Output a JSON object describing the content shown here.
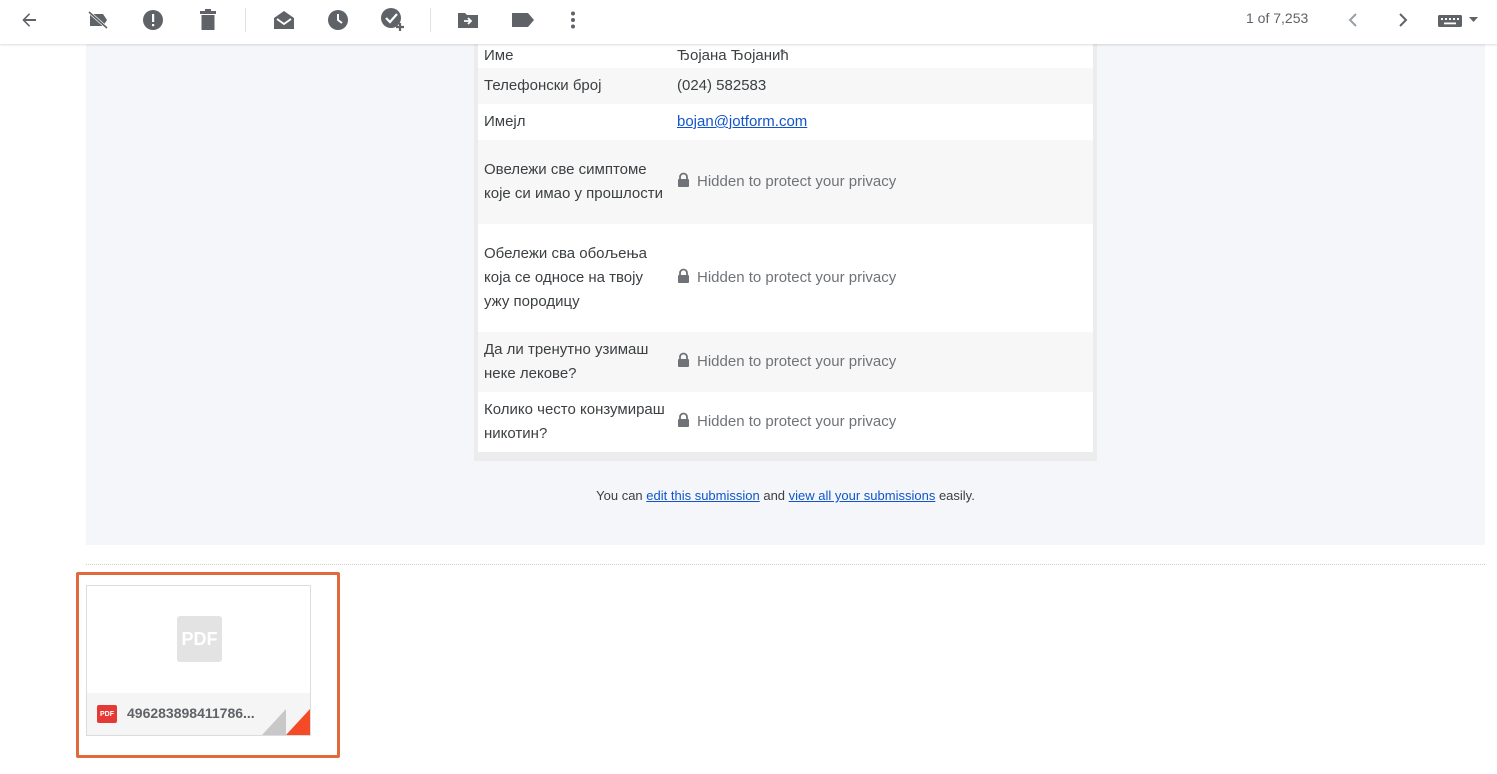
{
  "toolbar": {
    "buttons": [
      "back",
      "report-spam",
      "report-phishing",
      "delete",
      "mark-unread",
      "snooze",
      "add-task",
      "move-to",
      "labels",
      "more"
    ],
    "count": "1 of 7,253",
    "accent": "#5f6368"
  },
  "form": {
    "rows": [
      {
        "q": "Име",
        "a": "Ђојана Ђојанић"
      },
      {
        "q": "Телефонски број",
        "a": "(024) 582583"
      },
      {
        "q": "Имејл",
        "a": "bojan@jotform.com"
      },
      {
        "q": "Овележи све симптоме које си имао у прошлости",
        "a": "Hidden to protect your privacy"
      },
      {
        "q": "Обележи сва обољења која се односе на твоју ужу породицу",
        "a": "Hidden to protect your privacy"
      },
      {
        "q": "Да ли тренутно узимаш неке лекове?",
        "a": "Hidden to protect your privacy"
      },
      {
        "q": "Колико често конзумираш никотин?",
        "a": "Hidden to protect your privacy"
      }
    ],
    "link_color": "#1155cc"
  },
  "footer": {
    "prefix": "You can ",
    "edit_link": "edit this submission",
    "middle": " and ",
    "view_link": "view all your submissions",
    "suffix": " easily."
  },
  "attachment": {
    "thumb_label": "PDF",
    "type_badge": "PDF",
    "name": "496283898411786...",
    "highlight": "#e06a3b",
    "badge_color": "#e53935"
  }
}
